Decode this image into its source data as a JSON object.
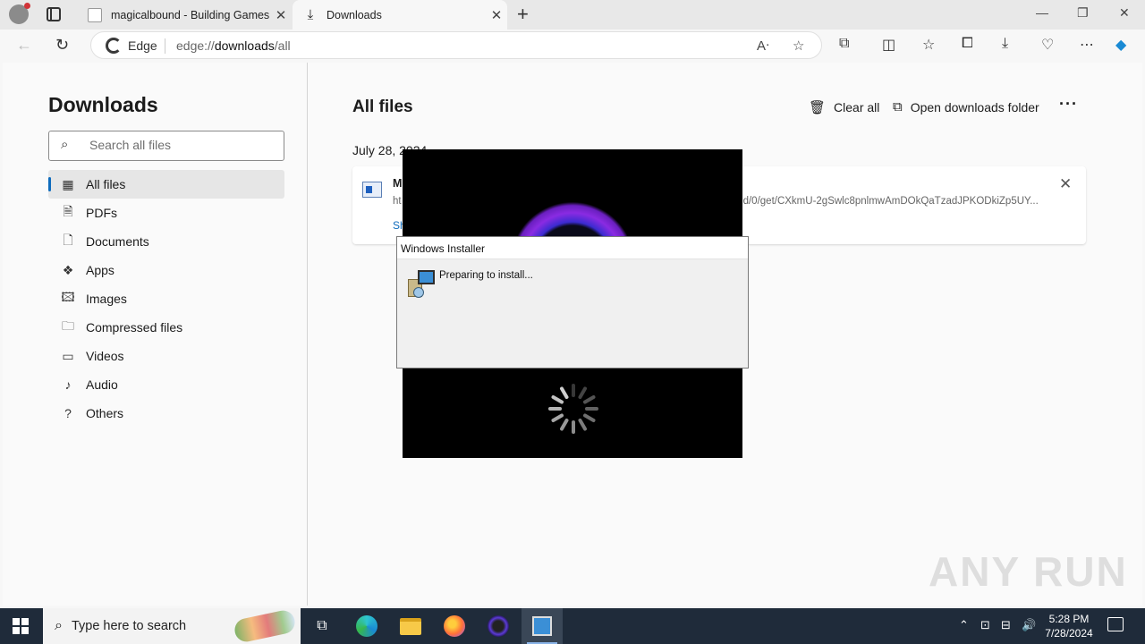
{
  "browser": {
    "tabs": [
      {
        "title": "magicalbound - Building Games"
      },
      {
        "title": "Downloads"
      }
    ],
    "new_tab": "+",
    "edge_label": "Edge",
    "url_prefix": "edge://",
    "url_bold": "downloads",
    "url_suffix": "/all"
  },
  "sidebar": {
    "title": "Downloads",
    "search_placeholder": "Search all files",
    "items": [
      {
        "label": "All files",
        "icon": "grid-icon",
        "glyph": "▦"
      },
      {
        "label": "PDFs",
        "icon": "pdf-icon",
        "glyph": "🗎"
      },
      {
        "label": "Documents",
        "icon": "document-icon",
        "glyph": "🗋"
      },
      {
        "label": "Apps",
        "icon": "apps-icon",
        "glyph": "❖"
      },
      {
        "label": "Images",
        "icon": "image-icon",
        "glyph": "🖾"
      },
      {
        "label": "Compressed files",
        "icon": "zip-icon",
        "glyph": "🗀"
      },
      {
        "label": "Videos",
        "icon": "video-icon",
        "glyph": "▭"
      },
      {
        "label": "Audio",
        "icon": "audio-icon",
        "glyph": "♪"
      },
      {
        "label": "Others",
        "icon": "others-icon",
        "glyph": "?"
      }
    ]
  },
  "main": {
    "title": "All files",
    "clear_all": "Clear all",
    "open_folder": "Open downloads folder",
    "more": "···",
    "date_group": "July 28, 2024",
    "download": {
      "name": "M",
      "url_start": "ht",
      "url_end": "d/0/get/CXkmU-2gSwlc8pnlmwAmDOkQaTzadJPKODkiZp5UY...",
      "show": "Sh"
    }
  },
  "installer": {
    "title": "Windows Installer",
    "message": "Preparing to install..."
  },
  "watermark": "ANY RUN",
  "taskbar": {
    "search_text": "Type here to search",
    "time": "5:28 PM",
    "date": "7/28/2024"
  },
  "colors": {
    "accent": "#0f6cbd",
    "taskbar": "#1f2b3a"
  }
}
